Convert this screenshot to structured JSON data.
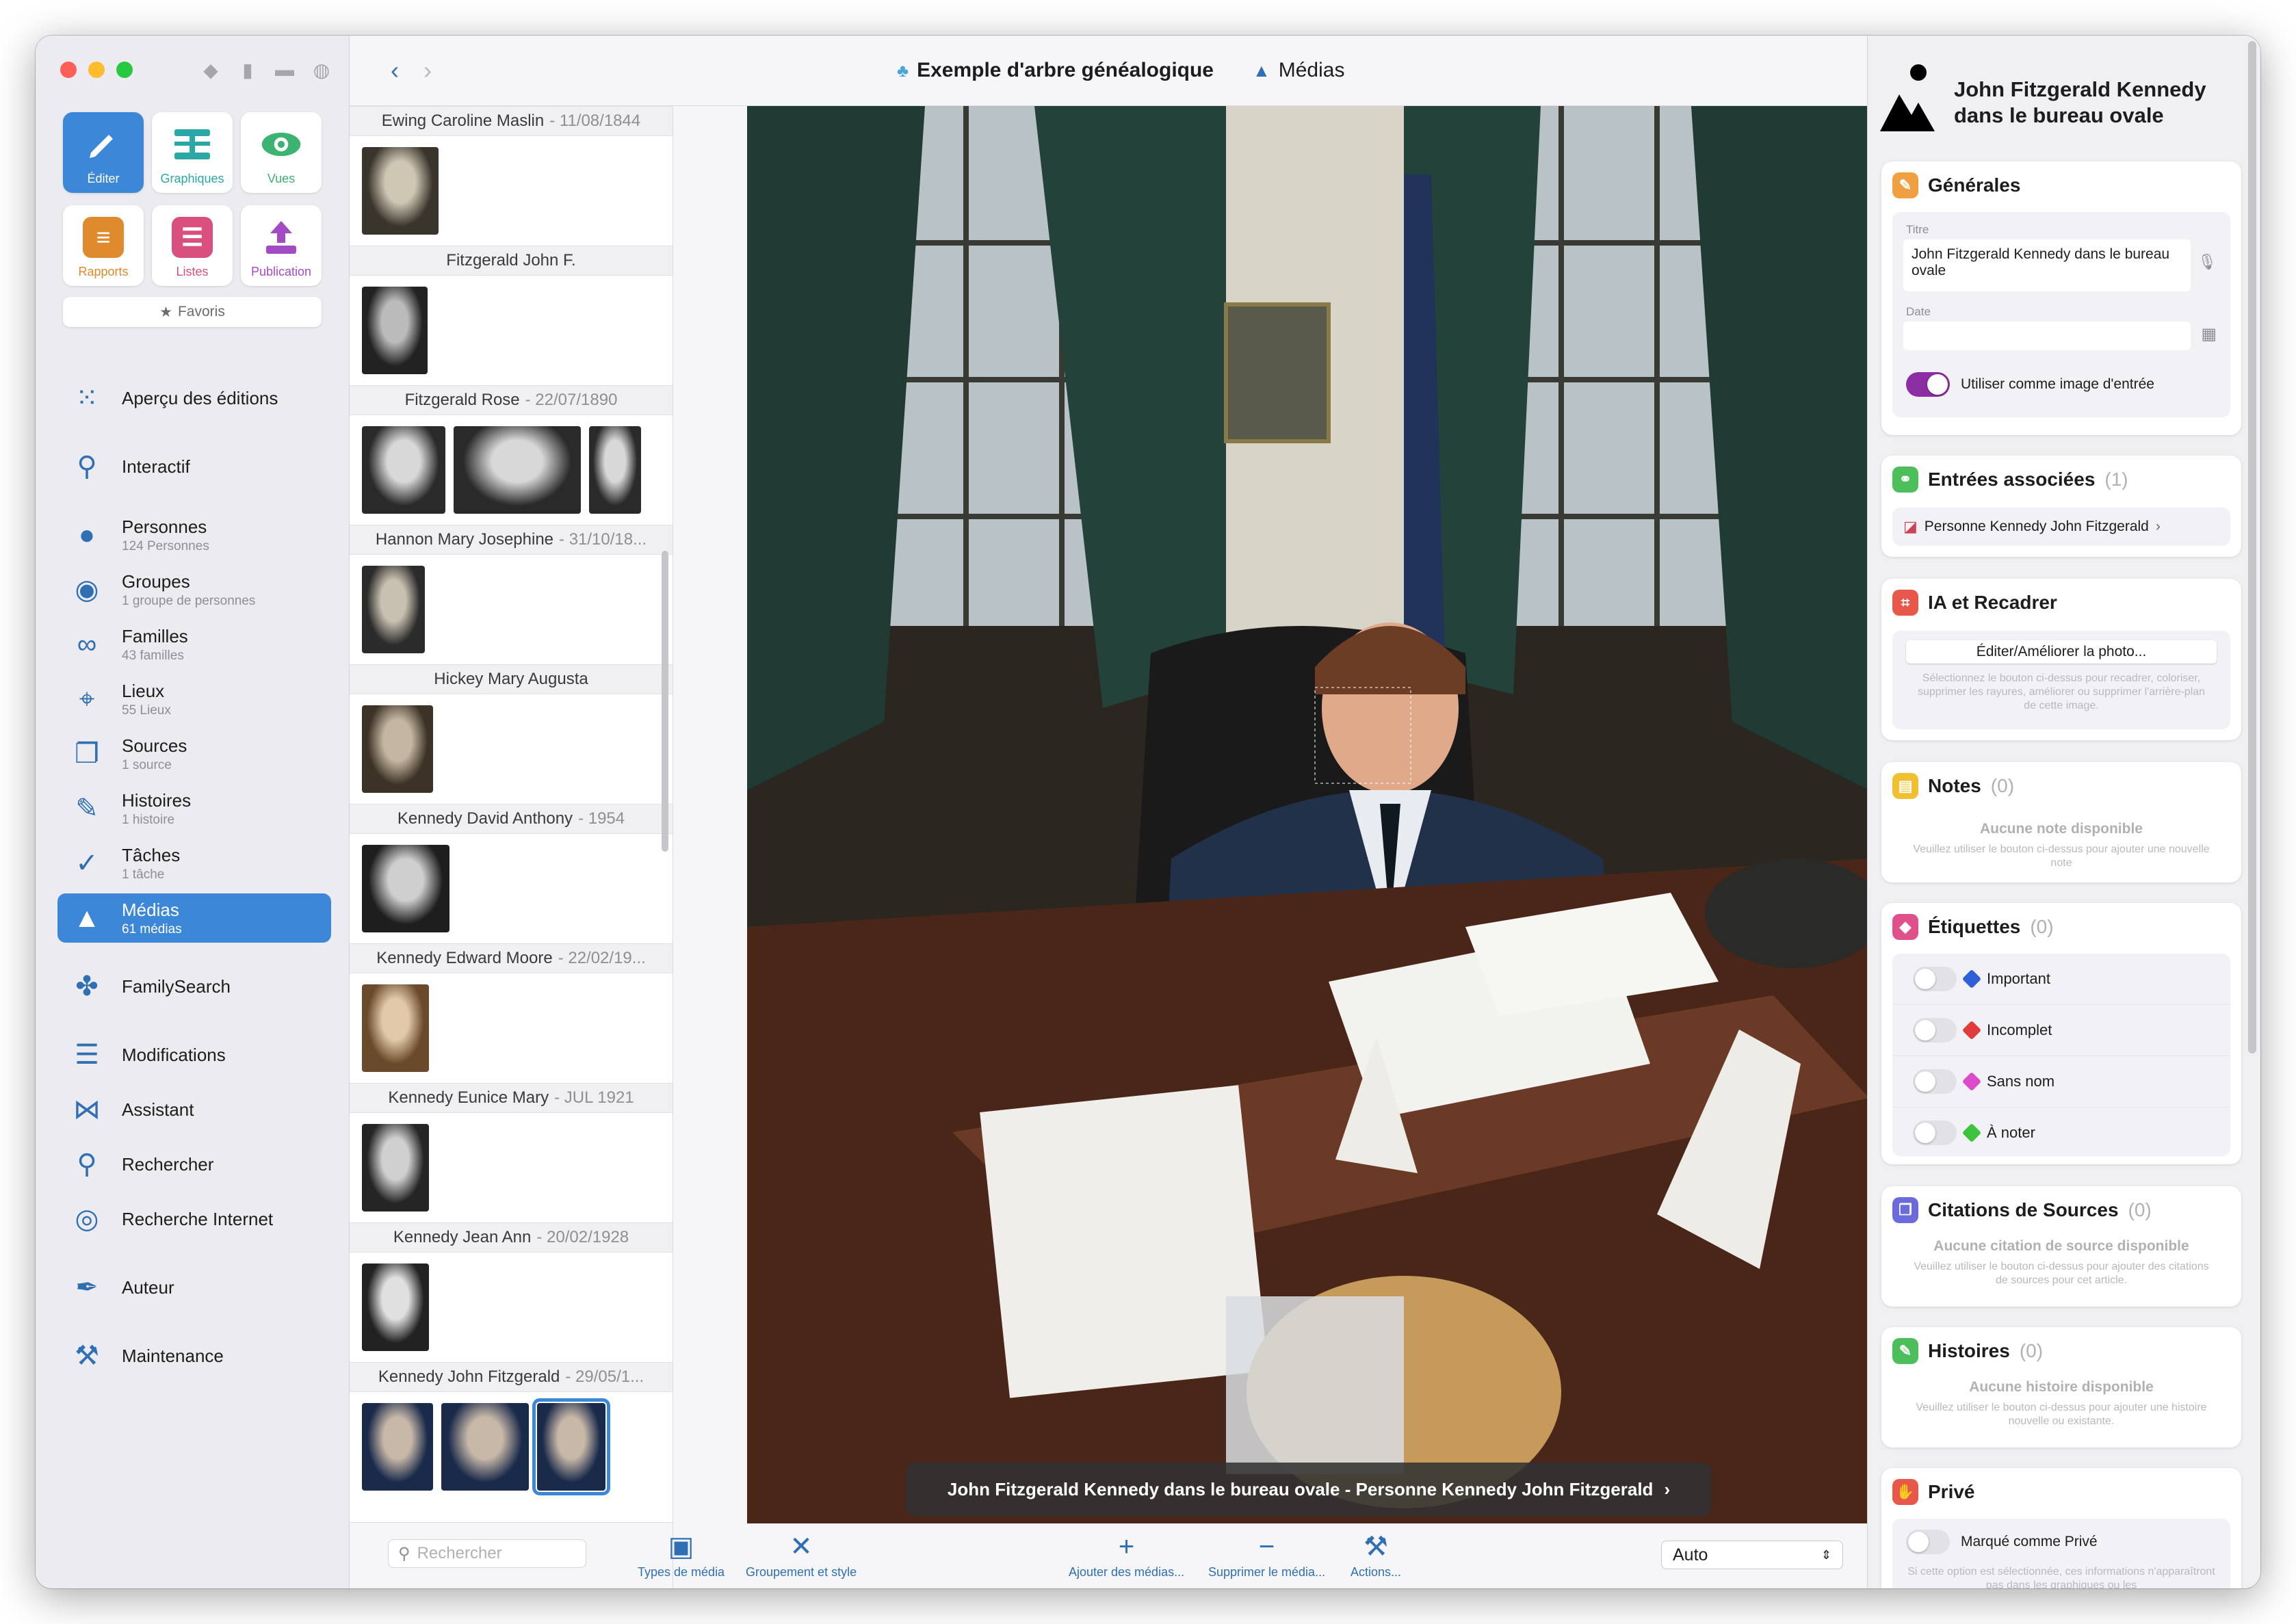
{
  "toolbar": {
    "back_icon": "chevron-left",
    "forward_icon": "chevron-right",
    "tree_title": "Exemple d'arbre généalogique",
    "section_title": "Médias",
    "help": "?"
  },
  "sidebar": {
    "tiles": [
      {
        "label": "Éditer",
        "icon": "pencil",
        "color": "#3d87d9"
      },
      {
        "label": "Graphiques",
        "icon": "chart-tree",
        "color": "#2aa7a7"
      },
      {
        "label": "Vues",
        "icon": "eye",
        "color": "#3cb371"
      },
      {
        "label": "Rapports",
        "icon": "report",
        "color": "#e08a2e"
      },
      {
        "label": "Listes",
        "icon": "list",
        "color": "#d9507f"
      },
      {
        "label": "Publication",
        "icon": "upload",
        "color": "#a34bc4"
      }
    ],
    "favorites": "Favoris",
    "nav": [
      {
        "label": "Aperçu des éditions",
        "sub": "",
        "icon": "grid-dots-icon"
      },
      {
        "label": "Interactif",
        "sub": "",
        "icon": "tree-icon"
      },
      {
        "label": "Personnes",
        "sub": "124 Personnes",
        "icon": "person-icon"
      },
      {
        "label": "Groupes",
        "sub": "1 groupe de personnes",
        "icon": "group-icon"
      },
      {
        "label": "Familles",
        "sub": "43 familles",
        "icon": "rings-icon"
      },
      {
        "label": "Lieux",
        "sub": "55 Lieux",
        "icon": "pin-icon"
      },
      {
        "label": "Sources",
        "sub": "1 source",
        "icon": "sources-icon"
      },
      {
        "label": "Histoires",
        "sub": "1 histoire",
        "icon": "story-icon"
      },
      {
        "label": "Tâches",
        "sub": "1 tâche",
        "icon": "check-icon"
      },
      {
        "label": "Médias",
        "sub": "61 médias",
        "icon": "media-icon"
      },
      {
        "label": "FamilySearch",
        "sub": "",
        "icon": "familysearch-icon"
      },
      {
        "label": "Modifications",
        "sub": "",
        "icon": "list-lines-icon"
      },
      {
        "label": "Assistant",
        "sub": "",
        "icon": "assistant-icon"
      },
      {
        "label": "Rechercher",
        "sub": "",
        "icon": "search-icon"
      },
      {
        "label": "Recherche Internet",
        "sub": "",
        "icon": "globe-search-icon"
      },
      {
        "label": "Auteur",
        "sub": "",
        "icon": "pen-icon"
      },
      {
        "label": "Maintenance",
        "sub": "",
        "icon": "maintenance-icon"
      }
    ]
  },
  "list": {
    "groups": [
      {
        "name": "Ewing Caroline Maslin",
        "date": "- 11/08/1844",
        "thumbs": 1
      },
      {
        "name": "Fitzgerald John F.",
        "date": "",
        "thumbs": 1
      },
      {
        "name": "Fitzgerald Rose",
        "date": "- 22/07/1890",
        "thumbs": 3
      },
      {
        "name": "Hannon Mary Josephine",
        "date": "- 31/10/18...",
        "thumbs": 1
      },
      {
        "name": "Hickey Mary Augusta",
        "date": "",
        "thumbs": 1
      },
      {
        "name": "Kennedy David Anthony",
        "date": "- 1954",
        "thumbs": 1
      },
      {
        "name": "Kennedy Edward Moore",
        "date": "- 22/02/19...",
        "thumbs": 1
      },
      {
        "name": "Kennedy Eunice Mary",
        "date": "- JUL 1921",
        "thumbs": 1
      },
      {
        "name": "Kennedy Jean Ann",
        "date": "- 20/02/1928",
        "thumbs": 1
      },
      {
        "name": "Kennedy John Fitzgerald",
        "date": "- 29/05/1...",
        "thumbs": 3
      }
    ],
    "search_placeholder": "Rechercher"
  },
  "viewer": {
    "caption": "John Fitzgerald Kennedy dans le bureau ovale - Personne Kennedy John Fitzgerald"
  },
  "bottom_tools": [
    {
      "label": "Types de média",
      "icon": "media-type-icon"
    },
    {
      "label": "Groupement et style",
      "icon": "grouping-icon"
    },
    {
      "label": "Ajouter des médias...",
      "icon": "plus-icon"
    },
    {
      "label": "Supprimer le média...",
      "icon": "minus-icon"
    },
    {
      "label": "Actions...",
      "icon": "hammer-icon"
    }
  ],
  "zoom": {
    "value": "Auto"
  },
  "detail": {
    "title_line1": "John Fitzgerald Kennedy",
    "title_line2": "dans le bureau ovale",
    "general": {
      "heading": "Générales",
      "title_label": "Titre",
      "title_value": "John Fitzgerald Kennedy dans le bureau ovale",
      "date_label": "Date",
      "date_value": "",
      "use_as_entry": "Utiliser comme image d'entrée",
      "use_as_entry_on": true
    },
    "associated": {
      "heading": "Entrées associées",
      "count": "(1)",
      "person": "Personne Kennedy John Fitzgerald"
    },
    "ai": {
      "heading": "IA et Recadrer",
      "button": "Éditer/Améliorer la photo...",
      "help": "Sélectionnez le bouton ci-dessus pour recadrer, coloriser, supprimer les rayures, améliorer ou supprimer l'arrière-plan de cette image."
    },
    "notes": {
      "heading": "Notes",
      "count": "(0)",
      "empty": "Aucune note disponible",
      "help": "Veuillez utiliser le bouton ci-dessus pour ajouter une nouvelle note"
    },
    "tags": {
      "heading": "Étiquettes",
      "count": "(0)",
      "items": [
        {
          "label": "Important",
          "color": "#2f5fd9"
        },
        {
          "label": "Incomplet",
          "color": "#e03c3c"
        },
        {
          "label": "Sans nom",
          "color": "#d94bc8"
        },
        {
          "label": "À noter",
          "color": "#3cc43c"
        }
      ]
    },
    "citations": {
      "heading": "Citations de Sources",
      "count": "(0)",
      "empty": "Aucune citation de source disponible",
      "help": "Veuillez utiliser le bouton ci-dessus pour ajouter des citations de sources pour cet article."
    },
    "stories": {
      "heading": "Histoires",
      "count": "(0)",
      "empty": "Aucune histoire disponible",
      "help": "Veuillez utiliser le bouton ci-dessus pour ajouter une histoire nouvelle ou existante."
    },
    "private": {
      "heading": "Privé",
      "toggle_label": "Marqué comme Privé",
      "help": "Si cette option est sélectionnée, ces informations n'apparaîtront pas dans les graphiques ou les"
    }
  }
}
